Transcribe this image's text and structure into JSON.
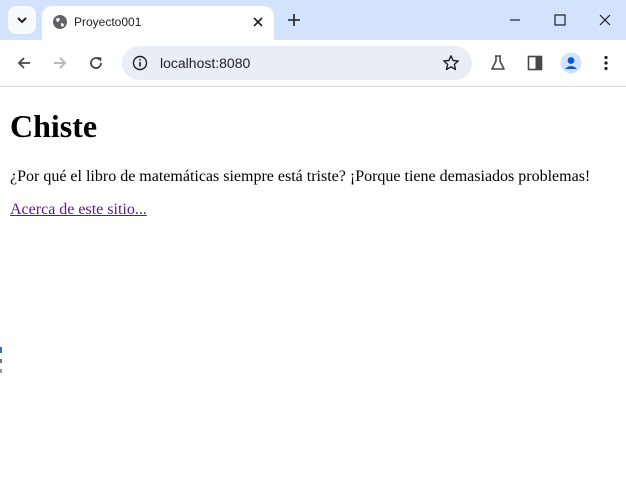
{
  "browser": {
    "tab": {
      "title": "Proyecto001"
    },
    "address_bar": {
      "url": "localhost:8080"
    },
    "icons": {
      "tab_search": "chevron-down-icon",
      "favicon": "globe-icon",
      "tab_close": "close-icon",
      "new_tab": "plus-icon",
      "minimize": "minimize-icon",
      "maximize": "maximize-icon",
      "close_window": "close-icon",
      "back": "back-arrow-icon",
      "forward": "forward-arrow-icon",
      "reload": "reload-icon",
      "site_info": "info-icon",
      "bookmark": "star-icon",
      "labs": "flask-icon",
      "side_panel": "side-panel-icon",
      "profile": "profile-icon",
      "menu": "kebab-menu-icon"
    }
  },
  "page": {
    "heading": "Chiste",
    "joke": "¿Por qué el libro de matemáticas siempre está triste? ¡Porque tiene demasiados problemas!",
    "link": "Acerca de este sitio..."
  }
}
